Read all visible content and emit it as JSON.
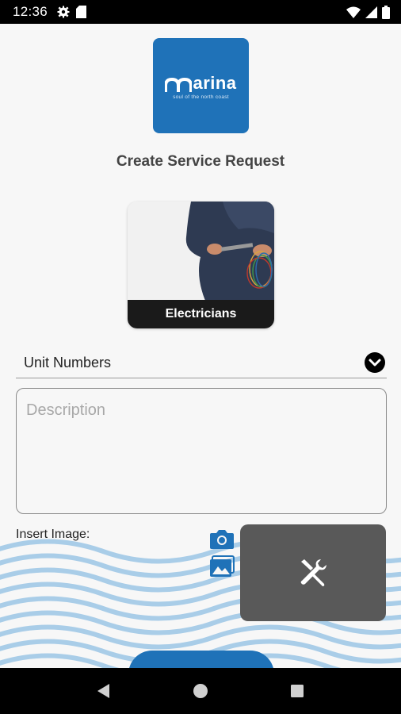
{
  "status_bar": {
    "time": "12:36",
    "left_icons": [
      "gear-icon",
      "sd-card-icon"
    ],
    "right_icons": [
      "wifi-icon",
      "signal-icon",
      "battery-icon"
    ]
  },
  "logo": {
    "brand": "arina",
    "tagline": "soul of the north coast"
  },
  "page_title": "Create Service Request",
  "category": {
    "label": "Electricians",
    "image": "electrician-photo"
  },
  "unit_select": {
    "label": "Unit Numbers",
    "icon": "chevron-down-icon"
  },
  "description": {
    "placeholder": "Description",
    "value": ""
  },
  "insert_image": {
    "label": "Insert Image:",
    "camera_icon": "camera-icon",
    "gallery_icon": "gallery-icon"
  },
  "overlay": {
    "icon": "tools-icon"
  },
  "colors": {
    "brand_blue": "#1f72b8",
    "wave_blue": "#a9cde8",
    "overlay_gray": "#595959",
    "background": "#f7f7f7"
  },
  "nav_bar": {
    "buttons": [
      "back-icon",
      "home-icon",
      "recents-icon"
    ]
  }
}
